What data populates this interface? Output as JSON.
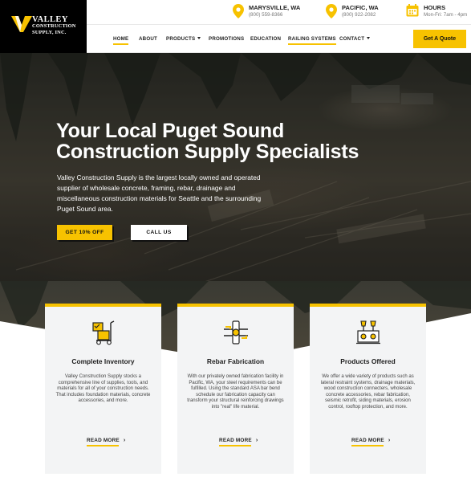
{
  "brand": {
    "logo_line1": "VALLEY",
    "logo_line2": "CONSTRUCTION",
    "logo_line3": "SUPPLY, INC.",
    "accent_color": "#f7c200",
    "logo_bg": "#000000"
  },
  "topbar": {
    "locations": [
      {
        "title": "MARYSVILLE, WA",
        "phone": "(800) 559-8366",
        "icon": "map-pin-icon"
      },
      {
        "title": "PACIFIC, WA",
        "phone": "(800) 922-2082",
        "icon": "map-pin-icon"
      }
    ],
    "hours": {
      "title": "HOURS",
      "text": "Mon-Fri: 7am - 4pm",
      "icon": "calendar-icon"
    }
  },
  "nav": {
    "items": [
      {
        "label": "HOME",
        "active": true
      },
      {
        "label": "ABOUT"
      },
      {
        "label": "PRODUCTS",
        "dropdown": true
      },
      {
        "label": "PROMOTIONS"
      },
      {
        "label": "EDUCATION"
      },
      {
        "label": "RAILING SYSTEMS",
        "underlined": true
      },
      {
        "label": "CONTACT",
        "dropdown": true
      }
    ],
    "cta_label": "Get A Quote"
  },
  "hero": {
    "title_line1": "Your Local Puget Sound",
    "title_line2": "Construction Supply Specialists",
    "description": "Valley Construction Supply is the largest locally owned and operated supplier of wholesale concrete, framing, rebar, drainage and miscellaneous construction materials for Seattle and the surrounding Puget Sound area.",
    "primary_button": "GET 10% OFF",
    "secondary_button": "CALL US"
  },
  "cards": [
    {
      "icon": "hand-truck-boxes-icon",
      "title": "Complete Inventory",
      "text": "Valley Construction Supply stocks a comprehensive line of supplies, tools, and materials for all of your construction needs. That includes foundation materials, concrete accessories, and more.",
      "link": "READ MORE"
    },
    {
      "icon": "rebar-bender-icon",
      "title": "Rebar Fabrication",
      "text": "With our privately owned fabrication facility in Pacific, WA, your steel requirements can be fulfilled. Using the standard ASA bar bend schedule our fabrication capacity can transform your structural reinforcing drawings into \"real\" life material.",
      "link": "READ MORE"
    },
    {
      "icon": "concrete-products-icon",
      "title": "Products Offered",
      "text": "We offer a wide variety of products such as lateral restraint systems, drainage materials, wood construction connecters, wholesale concrete accessories, rebar fabrication, seismic retrofit, siding materials, erosion control, rooftop protection, and more.",
      "link": "READ MORE"
    }
  ]
}
